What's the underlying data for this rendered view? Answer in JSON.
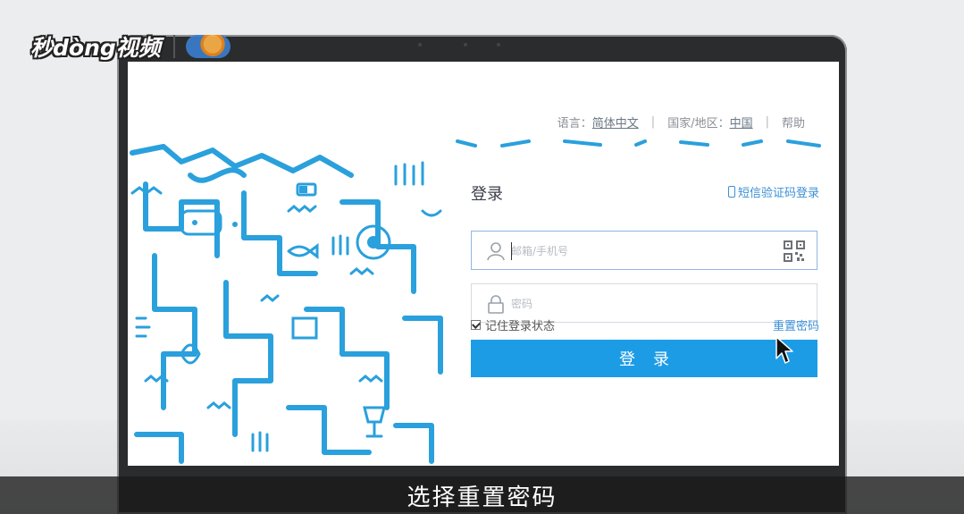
{
  "watermark": {
    "brand": "秒dòng视频"
  },
  "topnav": {
    "language_label": "语言：",
    "language_value": "简体中文",
    "region_label": "国家/地区：",
    "region_value": "中国",
    "help": "帮助",
    "separator": "|"
  },
  "login": {
    "title": "登录",
    "sms_login": "短信验证码登录",
    "account_placeholder": "邮箱/手机号",
    "password_placeholder": "密码",
    "remember_label": "记住登录状态",
    "remember_checked": true,
    "reset_password": "重置密码",
    "submit_label": "登录"
  },
  "subtitle": "选择重置密码",
  "colors": {
    "accent": "#1d9ce6",
    "link": "#3c8fd6",
    "doodle": "#2aa0dc"
  },
  "icons": [
    "user-icon",
    "lock-icon",
    "qr-code-icon",
    "phone-icon",
    "mouse-cursor-icon"
  ]
}
